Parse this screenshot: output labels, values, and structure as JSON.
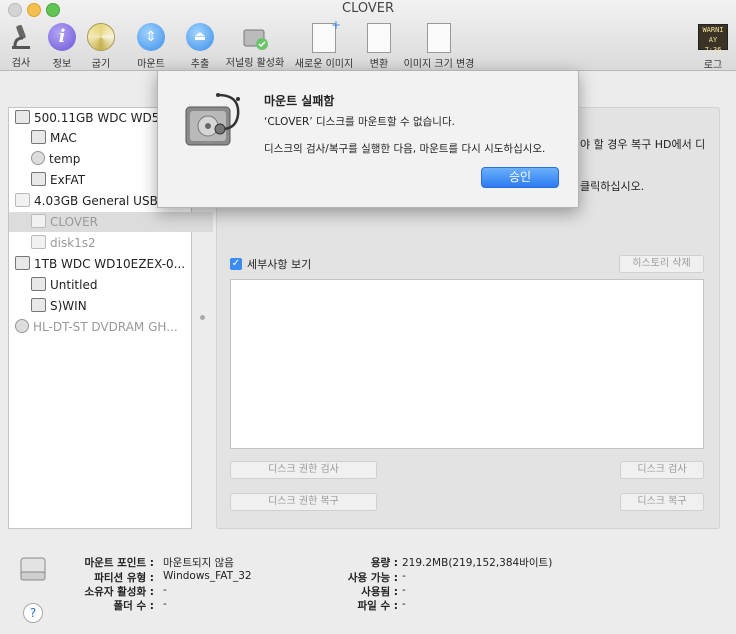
{
  "window": {
    "title": "CLOVER"
  },
  "toolbar": {
    "verify": "검사",
    "info": "정보",
    "burn": "굽기",
    "mount": "마운트",
    "eject": "추출",
    "journaling": "저널링 활성화",
    "new_image": "새로운 이미지",
    "convert": "변환",
    "resize": "이미지 크기 변경",
    "log": "로그",
    "log_badge_1": "WARNI",
    "log_badge_2": "AY 7:36"
  },
  "sidebar": {
    "items": [
      {
        "label": "500.11GB WDC WD50",
        "kind": "drive",
        "selected": false
      },
      {
        "label": "MAC",
        "kind": "volume",
        "selected": false
      },
      {
        "label": "temp",
        "kind": "volume",
        "selected": false
      },
      {
        "label": "ExFAT",
        "kind": "volume",
        "selected": false
      },
      {
        "label": "4.03GB General USB F",
        "kind": "drive",
        "selected": false
      },
      {
        "label": "CLOVER",
        "kind": "volume",
        "selected": true
      },
      {
        "label": "disk1s2",
        "kind": "volume",
        "selected": false
      },
      {
        "label": "1TB WDC WD10EZEX-0...",
        "kind": "drive",
        "selected": false
      },
      {
        "label": "Untitled",
        "kind": "volume",
        "selected": false
      },
      {
        "label": "S)WIN",
        "kind": "volume",
        "selected": false
      },
      {
        "label": "HL-DT-ST DVDRAM GH...",
        "kind": "optical",
        "selected": false
      }
    ]
  },
  "panel": {
    "partial_text_1": "야 할 경우 복구 HD에서 디",
    "partial_text_2": "클릭하십시오.",
    "details_label": "세부사항 보기",
    "details_checked": true,
    "clear_history": "히스토리 삭제",
    "verify_permissions": "디스크 권한 검사",
    "repair_permissions": "디스크 권한 복구",
    "verify_disk": "디스크 검사",
    "repair_disk": "디스크 복구"
  },
  "dialog": {
    "title": "마운트 실패함",
    "message": "‘CLOVER’ 디스크를 마운트할 수 없습니다.",
    "info": "디스크의 검사/복구를 실행한 다음, 마운트를 다시 시도하십시오.",
    "ok": "승인"
  },
  "info": {
    "mount_point_label": "마운트 포인트 :",
    "mount_point": "마운트되지 않음",
    "partition_type_label": "파티션 유형 :",
    "partition_type": "Windows_FAT_32",
    "owners_label": "소유자 활성화 :",
    "owners": "-",
    "folders_label": "폴더 수 :",
    "folders": "-",
    "capacity_label": "용량 :",
    "capacity": "219.2MB(219,152,384바이트)",
    "available_label": "사용 가능 :",
    "available": "-",
    "used_label": "사용됨 :",
    "used": "-",
    "files_label": "파일 수 :",
    "files": "-",
    "help": "?"
  },
  "colors": {
    "accent": "#3b8cf0"
  }
}
